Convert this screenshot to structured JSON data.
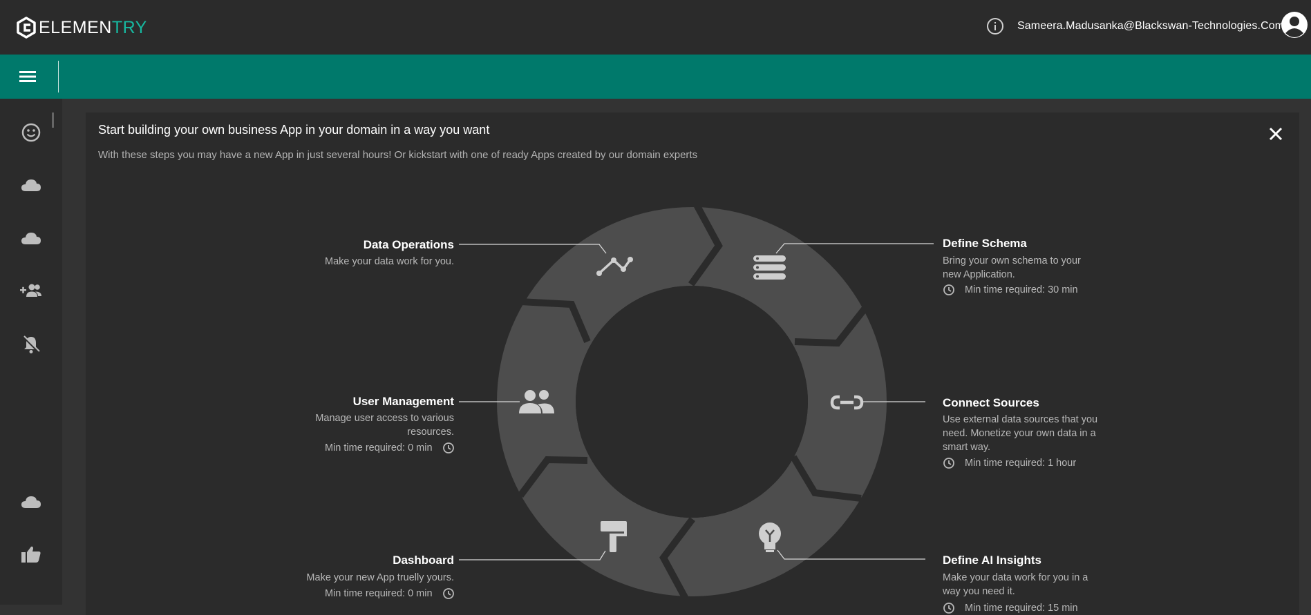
{
  "app": {
    "logo_part1": "ELEMEN",
    "logo_part2": "TRY",
    "brand_color": "#00796b",
    "accent_color": "#17b8a0"
  },
  "header": {
    "info_icon": "info-icon",
    "user_email": "Sameera.Madusanka@Blackswan-Technologies.Com",
    "avatar_icon": "account-circle-icon"
  },
  "sidebar": {
    "items": [
      {
        "icon": "smiley-icon"
      },
      {
        "icon": "cloud-icon"
      },
      {
        "icon": "cloud-icon"
      },
      {
        "icon": "add-group-icon"
      },
      {
        "icon": "notifications-off-icon"
      },
      {
        "icon": "cloud-icon"
      },
      {
        "icon": "thumb-up-icon"
      }
    ]
  },
  "card": {
    "title": "Start building your own business App in your domain in a way you want",
    "subtitle": "With these steps you may have a new App in just several hours! Or kickstart with one of ready Apps created by our domain experts",
    "close_icon": "close-icon"
  },
  "steps": {
    "data_operations": {
      "title": "Data Operations",
      "desc": "Make your data work for you."
    },
    "define_schema": {
      "title": "Define Schema",
      "desc": "Bring your own schema to your new Application.",
      "time": "Min time required: 30 min"
    },
    "user_management": {
      "title": "User Management",
      "desc": "Manage user access to various resources.",
      "time": "Min time required: 0 min"
    },
    "connect_sources": {
      "title": "Connect Sources",
      "desc": "Use external data sources that you need. Monetize your own data in a smart way.",
      "time": "Min time required: 1 hour"
    },
    "dashboard": {
      "title": "Dashboard",
      "desc": "Make your new App truelly yours.",
      "time": "Min time required: 0 min"
    },
    "define_ai_insights": {
      "title": "Define AI Insights",
      "desc": "Make your data work for you in a way you need it.",
      "time": "Min time required: 15 min"
    }
  }
}
